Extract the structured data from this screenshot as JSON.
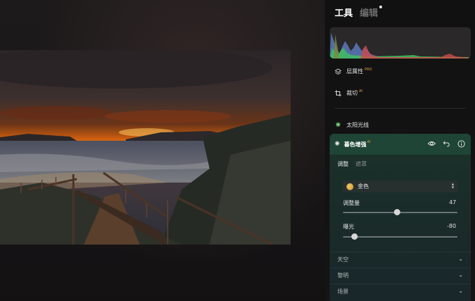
{
  "tabs": {
    "tools": "工具",
    "edit": "编辑"
  },
  "menu": {
    "layer_properties": "层属性",
    "layer_badge": "PRO",
    "crop": "裁切",
    "crop_badge": "AI",
    "sunlight": "太阳光线"
  },
  "card": {
    "title": "暮色增强",
    "badge": "AI",
    "subtabs": {
      "adjust": "调整",
      "mask": "遮罩"
    },
    "select_value": "金色",
    "sliders": [
      {
        "label": "调整量",
        "value": "47",
        "fraction": 0.47
      },
      {
        "label": "曝光",
        "value": "-80",
        "fraction": 0.1
      }
    ],
    "sections": [
      "天空",
      "黎明",
      "场景"
    ]
  },
  "colors": {
    "accent_green": "#1e4535",
    "panel_bg": "#121112"
  }
}
